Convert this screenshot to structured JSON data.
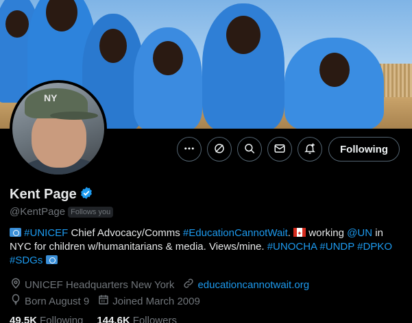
{
  "profile": {
    "name": "Kent Page",
    "handle": "@KentPage",
    "follows_you": "Follows you",
    "bio": {
      "part1_link": "#UNICEF",
      "part2": " Chief Advocacy/Comms ",
      "part3_link": "#EducationCannotWait",
      "part4": ". ",
      "part5": " working ",
      "part6_link": "@UN",
      "part7": " in NYC for children w/humanitarians & media. Views/mine. ",
      "part8_link": "#UNOCHA",
      "part9_link": "#UNDP",
      "part10_link": "#DPKO",
      "part11_link": "#SDGs"
    },
    "location": "UNICEF Headquarters New York",
    "website": "educationcannotwait.org",
    "birthday": "Born August 9",
    "joined": "Joined March 2009",
    "following_count": "49.5K",
    "following_label": "Following",
    "followers_count": "144.6K",
    "followers_label": "Followers"
  },
  "actions": {
    "more_icon": "more-icon",
    "grok_icon": "grok-icon",
    "search_icon": "search-icon",
    "message_icon": "message-icon",
    "notify_icon": "notify-icon",
    "follow_button": "Following"
  },
  "avatar": {
    "cap_text": "NY"
  },
  "colors": {
    "accent": "#1d9bf0",
    "background": "#000000",
    "secondary_text": "#71767b"
  }
}
